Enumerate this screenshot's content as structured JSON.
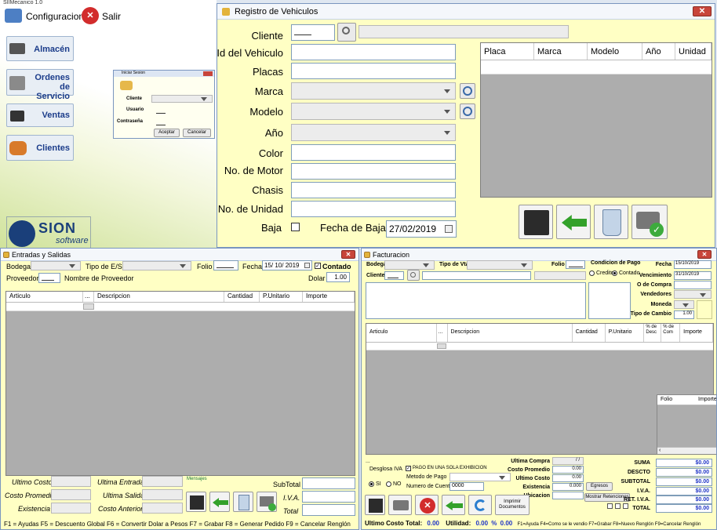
{
  "main_window": {
    "title": "SIIMecanico 1.0",
    "config_label": "Configuracion",
    "exit_label": "Salir",
    "menu": [
      "Almacén",
      "Ordenes de Servicio",
      "Ventas",
      "Clientes"
    ],
    "logo_text": "SION",
    "logo_sub": "software"
  },
  "login": {
    "title": "Iniciar Sesion",
    "cliente": "Cliente",
    "usuario": "Usuario",
    "contrasena": "Contraseña",
    "accept": "Aceptar",
    "cancel": "Cancelar"
  },
  "vehiculos": {
    "title": "Registro de Vehiculos",
    "labels": {
      "cliente": "Cliente",
      "id": "Id del Vehiculo",
      "placas": "Placas",
      "marca": "Marca",
      "modelo": "Modelo",
      "anio": "Año",
      "color": "Color",
      "motor": "No. de Motor",
      "chasis": "Chasis",
      "unidad": "No. de Unidad",
      "baja": "Baja",
      "fecha_baja": "Fecha de Baja"
    },
    "fecha_baja_value": "27/02/2019",
    "grid_headers": [
      "Placa",
      "Marca",
      "Modelo",
      "Año",
      "Unidad"
    ]
  },
  "entradas": {
    "title": "Entradas y Salidas",
    "bodega": "Bodega",
    "tipo": "Tipo de E/S",
    "folio": "Folio",
    "fecha": "Fecha",
    "fecha_value": "15/ 10/ 2019",
    "contado": "Contado",
    "proveedor": "Proveedor",
    "nombre_proveedor": "Nombre de Proveedor",
    "dolar": "Dolar",
    "dolar_value": "1.00",
    "grid_headers": [
      "Articulo",
      "...",
      "Descripcion",
      "Cantidad",
      "P.Unitario",
      "Importe"
    ],
    "ultimo_costo": "Ultimo Costo",
    "costo_promedio": "Costo Promedio",
    "existencia": "Existencia",
    "ultima_entrada": "Ultima Entrada",
    "ultima_salida": "Ultima Salida",
    "costo_anterior": "Costo Anterior",
    "mensajes": "Mensajes",
    "subtotal": "SubTotal",
    "iva": "I.V.A.",
    "total": "Total",
    "footer": "F1 = Ayudas  F5 = Descuento Global  F6 = Convertir Dolar a Pesos  F7 = Grabar  F8 = Generar Pedido  F9 = Cancelar Renglón"
  },
  "facturacion": {
    "title": "Facturacion",
    "bodega": "Bodega",
    "tipo_vta": "Tipo de Vta.",
    "folio": "Folio",
    "condicion": "Condicion de Pago",
    "credito": "Credito",
    "contado": "Contado",
    "fecha": "Fecha",
    "fecha_value": "15/10/2019",
    "vencimiento": "Vencimiento",
    "vencimiento_value": "31/10/2019",
    "o_compra": "O de Compra",
    "vendedores": "Vendedores",
    "moneda": "Moneda",
    "tipo_cambio": "Tipo de Cambio",
    "tipo_cambio_value": "1.00",
    "cliente": "Cliente",
    "grid_headers": [
      "Articulo",
      "...",
      "Descripcion",
      "Cantidad",
      "P.Unitario",
      "% de Desc",
      "% de Com",
      "Importe"
    ],
    "folio_grid": [
      "Folio",
      "Importe"
    ],
    "ellipsis": "...",
    "desglosa": "Desglosa IVA",
    "si": "SI",
    "no": "NO",
    "pago_una": "PAGO EN UNA SOLA EXHIBICION",
    "metodo": "Metodo de Pago",
    "numero_cuenta": "Numero de Cuenta",
    "cuenta_value": "0000",
    "ultima_compra": "Ultima Compra",
    "ultima_compra_value": "/  /",
    "costo_promedio": "Costo Promedio",
    "ultimo_costo": "Ultimo Costo",
    "existencia": "Existencia",
    "ubicacion": "Ubicacion",
    "zero": "0.00",
    "existencia_value": "0.000",
    "egresos": "Egresos",
    "mostrar_ret": "Mostrar Retenciones",
    "imprimir": "Imprimir Documentos",
    "suma": "SUMA",
    "descto": "DESCTO",
    "subtotal": "SUBTOTAL",
    "iva": "I.V.A.",
    "ret_iva": "RET. I.V.A.",
    "total": "TOTAL",
    "money": "$0.00",
    "footer_label1": "Ultimo Costo Total:",
    "footer_val1": "0.00",
    "footer_label2": "Utilidad:",
    "footer_val2": "0.00",
    "footer_pct": "%",
    "footer_val3": "0.00",
    "footer_keys": "F1=Ayuda  F4=Como se le vendio  F7=Grabar  F8=Nuevo Renglón  F9=Cancelar Renglón"
  },
  "colors": {
    "form_bg": "#ffffc4",
    "grid_bg": "#adadad",
    "accent": "#1e33c6"
  }
}
